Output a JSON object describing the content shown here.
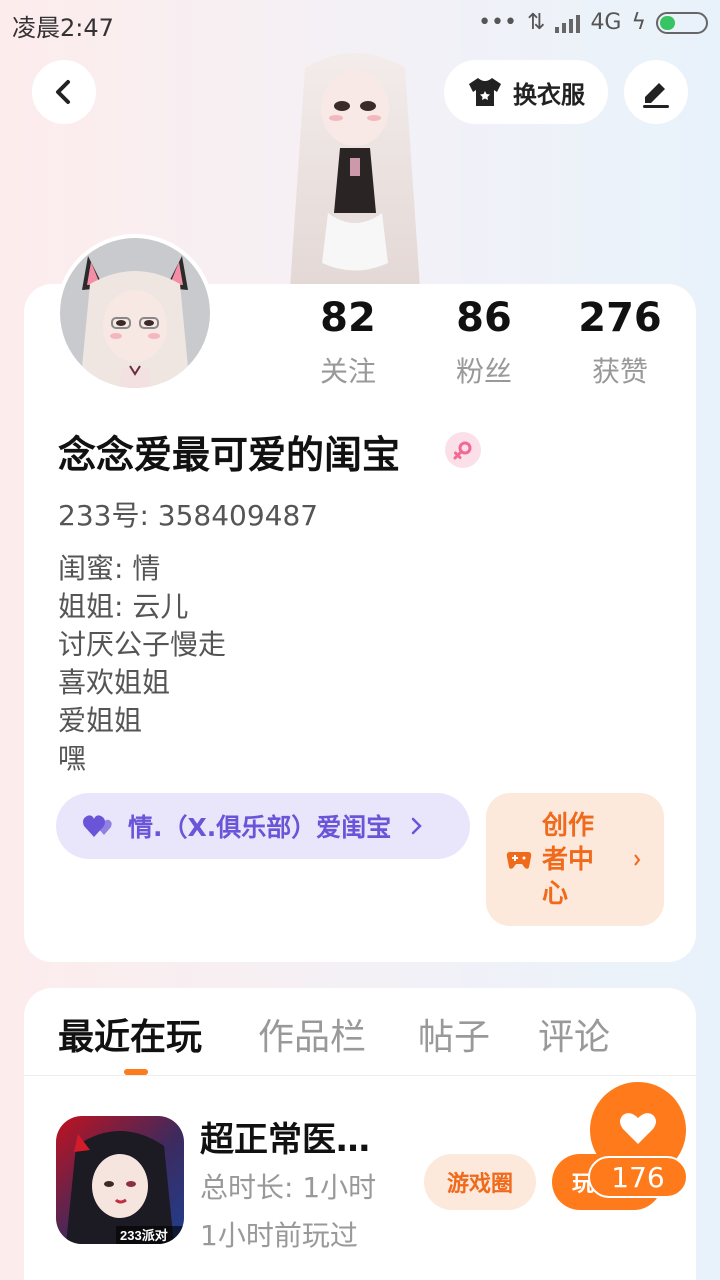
{
  "status_bar": {
    "time": "凌晨2:47",
    "network": "4G"
  },
  "header": {
    "outfit_label": "换衣服"
  },
  "profile": {
    "stats": [
      {
        "value": "82",
        "label": "关注"
      },
      {
        "value": "86",
        "label": "粉丝"
      },
      {
        "value": "276",
        "label": "获赞"
      }
    ],
    "nickname": "念念爱最可爱的闺宝",
    "gender": "female",
    "uid": "233号: 358409487",
    "bio": [
      "闺蜜: 情",
      "姐姐: 云儿",
      "讨厌公子慢走",
      "喜欢姐姐",
      "爱姐姐",
      "嘿"
    ],
    "club_label": "情.（X.俱乐部）爱闺宝",
    "creator_label": "创作者中心"
  },
  "tabs": [
    "最近在玩",
    "作品栏",
    "帖子",
    "评论"
  ],
  "game": {
    "title": "超正常医…",
    "duration": "总时长: 1小时",
    "last_played": "1小时前玩过",
    "icon_text": "233派对",
    "circle_button": "游戏圈",
    "play_button": "玩"
  },
  "like": {
    "count": "176"
  },
  "colors": {
    "accent": "#ff7a1a",
    "club_text": "#6a55d8",
    "club_bg": "#e9e6fb",
    "creator_bg": "#fde8dc"
  }
}
